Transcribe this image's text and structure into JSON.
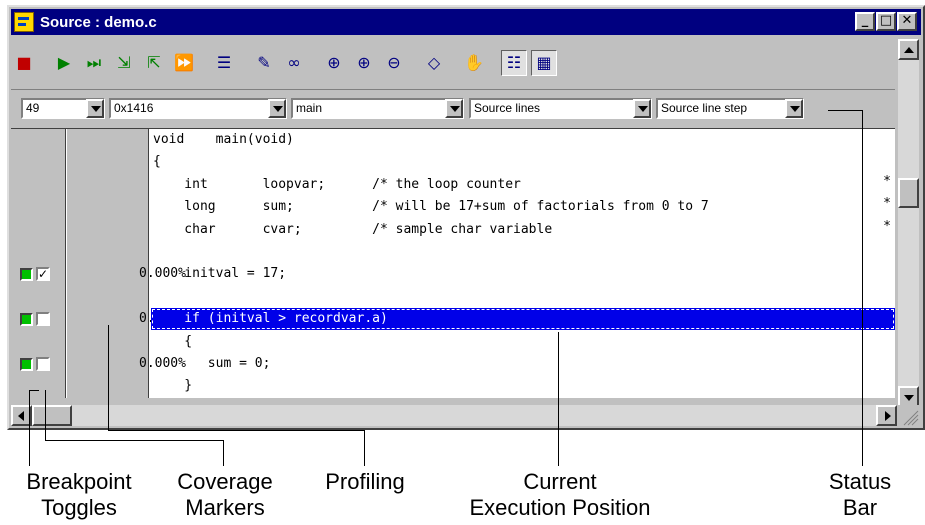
{
  "window": {
    "title": "Source : demo.c",
    "controls": [
      "_",
      "□",
      "✕"
    ]
  },
  "toolbar": {
    "tools": [
      {
        "name": "stop-icon",
        "glyph": "■",
        "color": "red"
      },
      {
        "name": "go-icon",
        "glyph": "▶",
        "color": "green"
      },
      {
        "name": "step-over-icon",
        "glyph": "⏭",
        "color": "green"
      },
      {
        "name": "step-into-icon",
        "glyph": "⇲",
        "color": "green"
      },
      {
        "name": "step-out-icon",
        "glyph": "⇱",
        "color": "green"
      },
      {
        "name": "run-to-cursor-icon",
        "glyph": "⏩",
        "color": "green"
      },
      {
        "name": "view-source-icon",
        "glyph": "☰",
        "color": "navy"
      },
      {
        "name": "set-breakpoint-icon",
        "glyph": "✎",
        "color": "navy"
      },
      {
        "name": "watch-icon",
        "glyph": "∞",
        "color": "navy"
      },
      {
        "name": "zoom-icon",
        "glyph": "⊕",
        "color": "navy"
      },
      {
        "name": "zoom-in-icon",
        "glyph": "⊕",
        "color": "navy"
      },
      {
        "name": "zoom-out-icon",
        "glyph": "⊖",
        "color": "navy"
      },
      {
        "name": "bookmark-icon",
        "glyph": "◇",
        "color": "navy"
      },
      {
        "name": "hand-icon",
        "glyph": "✋",
        "color": "navy"
      },
      {
        "name": "source-mode-icon",
        "glyph": "☷",
        "color": "navy",
        "pressed": true
      },
      {
        "name": "mixed-mode-icon",
        "glyph": "▦",
        "color": "navy",
        "pressed": true
      }
    ]
  },
  "combos": {
    "line": "49",
    "address": "0x1416",
    "function": "main",
    "view": "Source lines",
    "step": "Source line step"
  },
  "code_lines": [
    {
      "text": "void    main(void)",
      "current": false,
      "bp": false,
      "pct": ""
    },
    {
      "text": "{",
      "current": false,
      "bp": false,
      "pct": ""
    },
    {
      "text": "    int       loopvar;      /* the loop counter",
      "current": false,
      "bp": false,
      "pct": "",
      "trunc": "*"
    },
    {
      "text": "    long      sum;          /* will be 17+sum of factorials from 0 to 7",
      "current": false,
      "bp": false,
      "pct": "",
      "trunc": "*"
    },
    {
      "text": "    char      cvar;         /* sample char variable",
      "current": false,
      "bp": false,
      "pct": "",
      "trunc": "*"
    },
    {
      "text": "",
      "current": false,
      "bp": false,
      "pct": ""
    },
    {
      "text": "    initval = 17;",
      "current": false,
      "bp": true,
      "checked": true,
      "pct": "0.000%"
    },
    {
      "text": "",
      "current": false,
      "bp": false,
      "pct": ""
    },
    {
      "text": "    if (initval > recordvar.a)",
      "current": true,
      "bp": true,
      "checked": false,
      "pct": "0.000%"
    },
    {
      "text": "    {",
      "current": false,
      "bp": false,
      "pct": ""
    },
    {
      "text": "       sum = 0;",
      "current": false,
      "bp": true,
      "checked": false,
      "pct": "0.000%"
    },
    {
      "text": "    }",
      "current": false,
      "bp": false,
      "pct": ""
    }
  ],
  "callouts": {
    "breakpoint": "Breakpoint\nToggles",
    "coverage": "Coverage\nMarkers",
    "profiling": "Profiling",
    "current": "Current\nExecution Position",
    "status": "Status\nBar"
  },
  "colors": {
    "titlebar": "#000080",
    "current_line": "#0000e8",
    "breakpoint": "#00c000"
  }
}
